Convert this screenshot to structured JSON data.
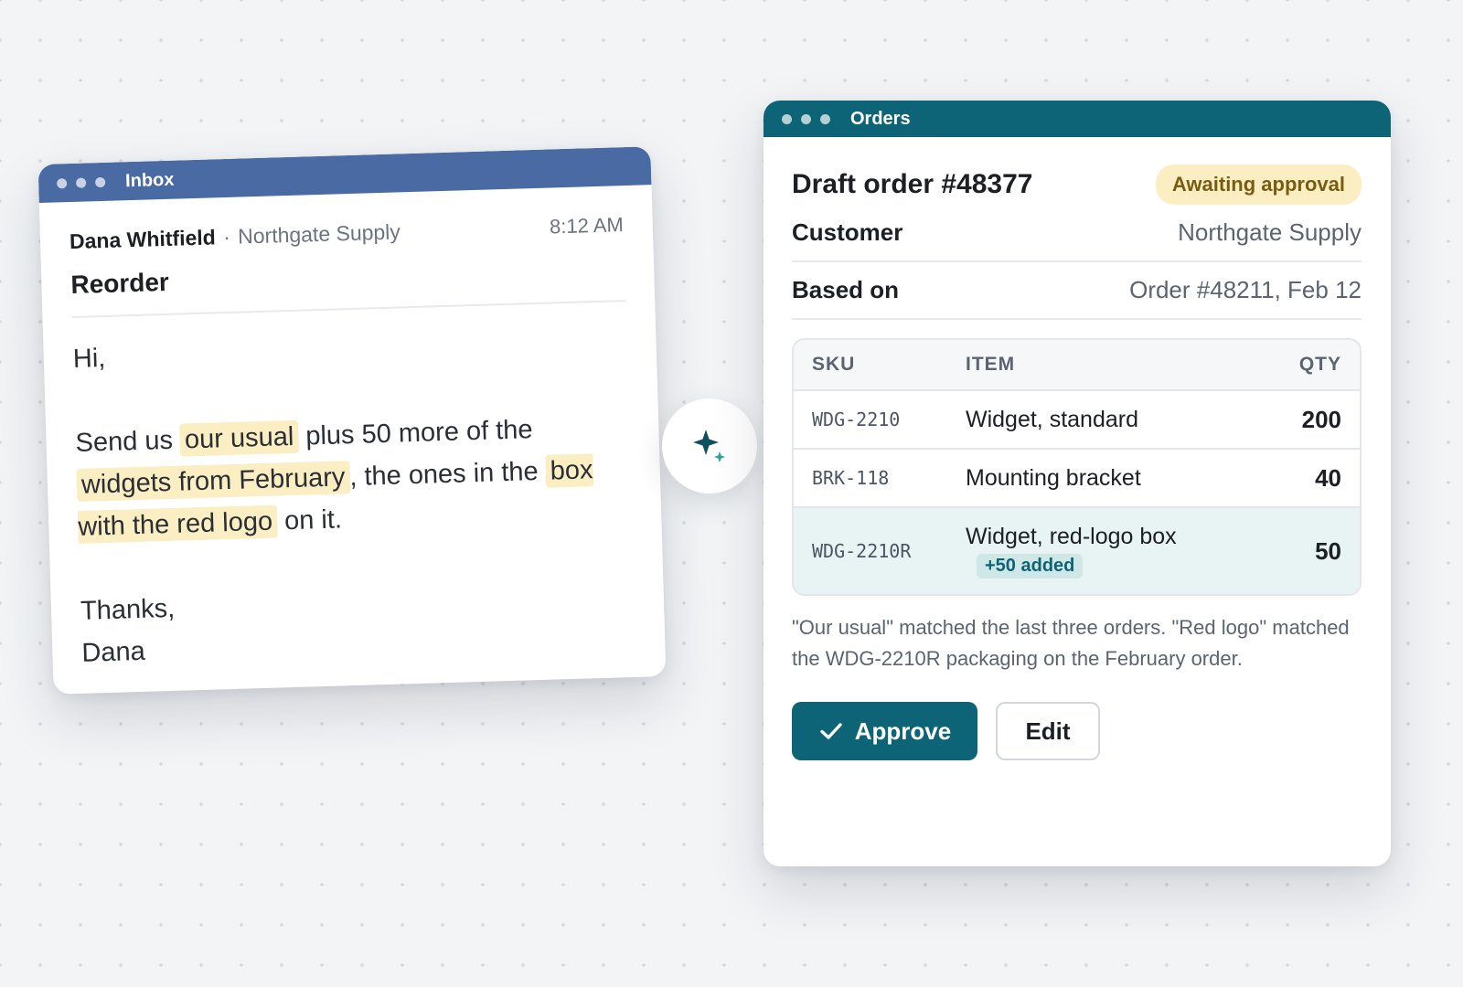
{
  "inbox": {
    "title": "Inbox",
    "sender_name": "Dana Whitfield",
    "sender_sep": "·",
    "sender_company": "Northgate Supply",
    "time": "8:12 AM",
    "subject": "Reorder",
    "greeting": "Hi,",
    "body": {
      "t1": "Send us ",
      "h1": "our usual",
      "t2": " plus 50 more of the ",
      "h2": "widgets from February",
      "t3": ", the ones in the ",
      "h3": "box with the red logo",
      "t4": " on it."
    },
    "closing": "Thanks,",
    "signature": "Dana"
  },
  "sparkle": {
    "icon": "sparkle-icon"
  },
  "orders": {
    "title": "Orders",
    "order_title": "Draft order #48377",
    "status": "Awaiting approval",
    "customer_label": "Customer",
    "customer_value": "Northgate Supply",
    "based_on_label": "Based on",
    "based_on_value": "Order #48211, Feb 12",
    "table": {
      "headers": {
        "sku": "SKU",
        "item": "ITEM",
        "qty": "QTY"
      },
      "rows": [
        {
          "sku": "WDG-2210",
          "item": "Widget, standard",
          "qty": "200"
        },
        {
          "sku": "BRK-118",
          "item": "Mounting bracket",
          "qty": "40"
        },
        {
          "sku": "WDG-2210R",
          "item": "Widget, red-logo box",
          "qty": "50",
          "tag": "+50 added"
        }
      ]
    },
    "note": "\"Our usual\" matched the last three orders. \"Red logo\" matched the WDG-2210R packaging on the February order.",
    "approve_label": "Approve",
    "edit_label": "Edit"
  },
  "colors": {
    "inbox_bar": "#4a6aa3",
    "orders_bar": "#0d6477",
    "highlight": "#fbeec2",
    "accent": "#0d6477"
  }
}
